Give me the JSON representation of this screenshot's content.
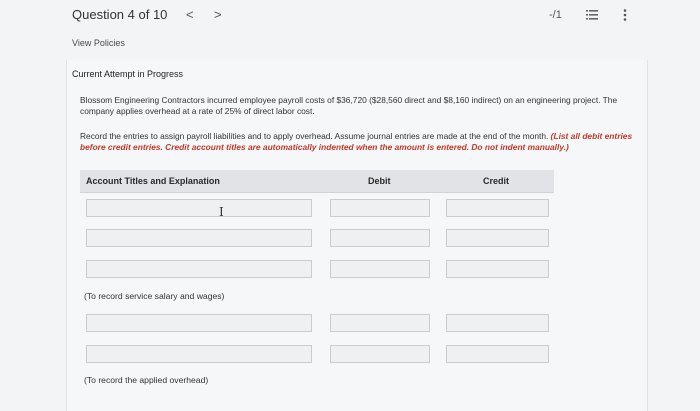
{
  "header": {
    "question_label": "Question 4 of 10",
    "prev_glyph": "<",
    "next_glyph": ">",
    "score": "-/1",
    "list_icon": "list-icon",
    "more_icon": "more-vertical-icon"
  },
  "view_policies": "View Policies",
  "attempt_label": "Current Attempt in Progress",
  "problem_text": "Blossom Engineering Contractors incurred employee payroll costs of $36,720 ($28,560 direct and $8,160 indirect) on an engineering project. The company applies overhead at a rate of 25% of direct labor cost.",
  "instructions": {
    "text": "Record the entries to assign payroll liabilities and to apply overhead. Assume journal entries are made at the end of the month. ",
    "emphasis": "(List all debit entries before credit entries. Credit account titles are automatically indented when the amount is entered. Do not indent manually.)"
  },
  "table": {
    "headers": {
      "account": "Account Titles and Explanation",
      "debit": "Debit",
      "credit": "Credit"
    },
    "memos": {
      "entry1": "(To record service salary and wages)",
      "entry2": "(To record the applied overhead)"
    },
    "entry1_rows": [
      {
        "account": "",
        "debit": "",
        "credit": ""
      },
      {
        "account": "",
        "debit": "",
        "credit": ""
      },
      {
        "account": "",
        "debit": "",
        "credit": ""
      }
    ],
    "entry2_rows": [
      {
        "account": "",
        "debit": "",
        "credit": ""
      },
      {
        "account": "",
        "debit": "",
        "credit": ""
      }
    ]
  },
  "colors": {
    "background": "#f3f4f5",
    "header_bg": "#e1e3e6",
    "emphasis_red": "#c0392b"
  }
}
